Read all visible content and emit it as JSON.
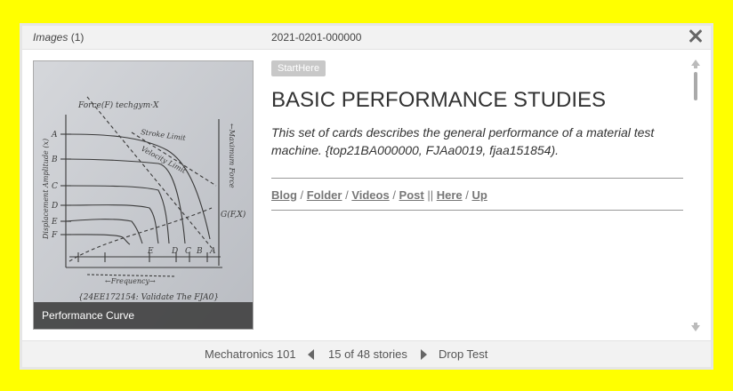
{
  "header": {
    "images_word": "Images",
    "images_count": "(1)",
    "record_id": "2021-0201-000000"
  },
  "image": {
    "caption": "Performance Curve",
    "sketch_text": {
      "top_label": "Force(F) techgym·X",
      "stroke_limit": "Stroke Limit",
      "velocity_limit": "Velocity Limit",
      "left_axis": "Displacement Amplitude (x)",
      "right_axis": "←Maximum Force",
      "frequency": "←Frequency→",
      "bottom_note": "{24EE172154: Validate The FJA0}",
      "g_label": "G(F,X)",
      "letters_left": [
        "A",
        "B",
        "C",
        "D",
        "E",
        "F"
      ],
      "letters_bottom": [
        "E",
        "D",
        "C",
        "B",
        "A"
      ]
    }
  },
  "content": {
    "tag": "StartHere",
    "title": "BASIC PERFORMANCE STUDIES",
    "description": "This set of cards describes the general performance of a material test machine. {top21BA000000, FJAa0019, fjaa151854).",
    "links": [
      "Blog",
      "Folder",
      "Videos",
      "Post",
      "Here",
      "Up"
    ],
    "separators": [
      " / ",
      " / ",
      " / ",
      " || ",
      " / "
    ]
  },
  "footer": {
    "prev": "Mechatronics 101",
    "counter": "15 of 48 stories",
    "next": "Drop Test"
  }
}
